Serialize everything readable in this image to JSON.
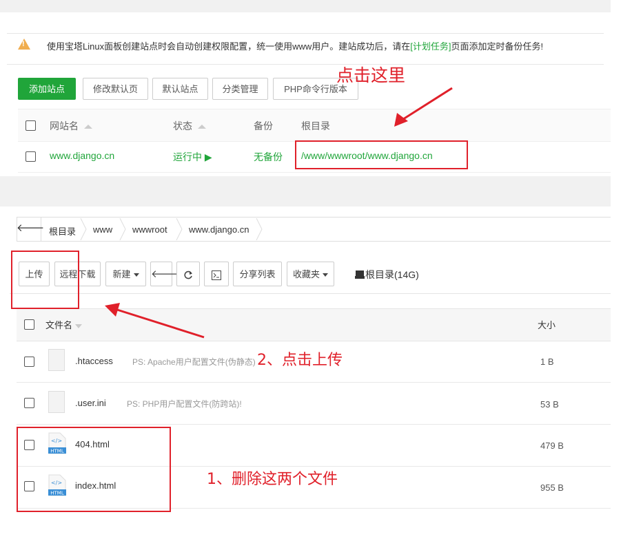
{
  "site_panel": {
    "notice": {
      "text_before": "使用宝塔Linux面板创建站点时会自动创建权限配置，统一使用www用户。建站成功后，请在",
      "link_text": "[计划任务]",
      "text_after": "页面添加定时备份任务!"
    },
    "buttons": {
      "add_site": "添加站点",
      "edit_default_page": "修改默认页",
      "default_site": "默认站点",
      "category_manage": "分类管理",
      "php_cli_version": "PHP命令行版本"
    },
    "columns": {
      "site_name": "网站名",
      "status": "状态",
      "backup": "备份",
      "root_dir": "根目录"
    },
    "rows": [
      {
        "site_name": "www.django.cn",
        "status": "运行中",
        "status_icon": "▶",
        "backup": "无备份",
        "root_dir": "/www/wwwroot/www.django.cn"
      }
    ],
    "annotation": "点击这里"
  },
  "file_panel": {
    "breadcrumb": [
      "根目录",
      "www",
      "wwwroot",
      "www.django.cn"
    ],
    "toolbar": {
      "upload": "上传",
      "remote_download": "远程下载",
      "new": "新建",
      "share_list": "分享列表",
      "favorites": "收藏夹",
      "disk_label": "根目录(14G)"
    },
    "columns": {
      "file_name": "文件名",
      "size": "大小"
    },
    "files": [
      {
        "name": ".htaccess",
        "note": "PS: Apache用户配置文件(伪静态)",
        "size": "1 B",
        "icon": "generic-file-icon"
      },
      {
        "name": ".user.ini",
        "note": "PS: PHP用户配置文件(防跨站)!",
        "size": "53 B",
        "icon": "generic-file-icon"
      },
      {
        "name": "404.html",
        "note": "",
        "size": "479 B",
        "icon": "html-file-icon"
      },
      {
        "name": "index.html",
        "note": "",
        "size": "955 B",
        "icon": "html-file-icon"
      }
    ],
    "html_icon_label": "HTML",
    "html_icon_code": "</>",
    "annotations": {
      "click_upload": "2、点击上传",
      "delete_files": "1、删除这两个文件"
    }
  },
  "colors": {
    "accent_green": "#20a53a",
    "annotation_red": "#e0202a",
    "warning": "#f0ad4e"
  }
}
